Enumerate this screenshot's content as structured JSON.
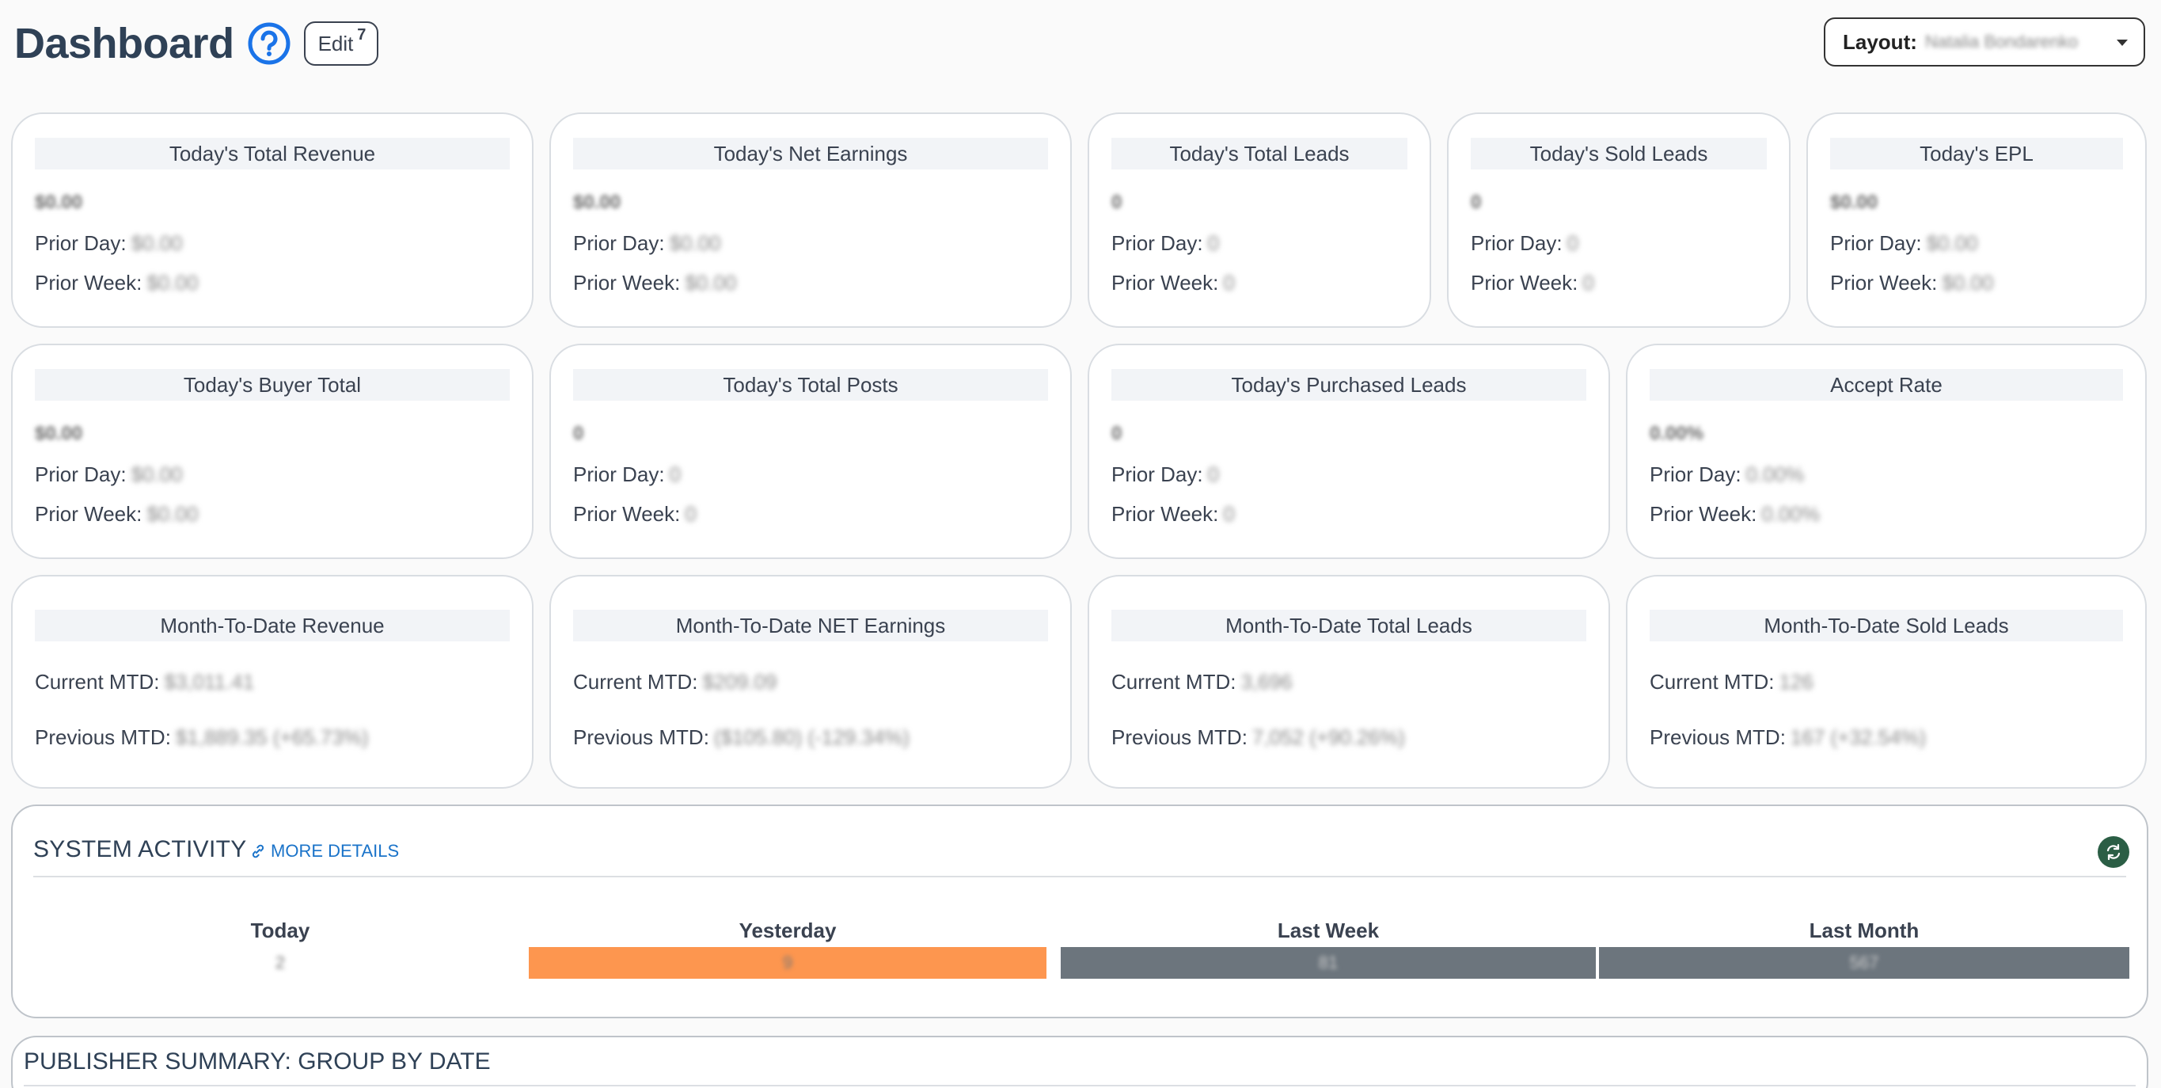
{
  "header": {
    "title": "Dashboard",
    "edit_label": "Edit",
    "edit_badge": "7",
    "layout_label": "Layout:",
    "layout_value": "Natalia Bondarenko"
  },
  "cards_row1": [
    {
      "title": "Today's Total Revenue",
      "value": "$0.00",
      "prior_day_label": "Prior Day:",
      "prior_day": "$0.00",
      "prior_week_label": "Prior Week:",
      "prior_week": "$0.00"
    },
    {
      "title": "Today's Net Earnings",
      "value": "$0.00",
      "prior_day_label": "Prior Day:",
      "prior_day": "$0.00",
      "prior_week_label": "Prior Week:",
      "prior_week": "$0.00"
    },
    {
      "title": "Today's Total Leads",
      "value": "0",
      "prior_day_label": "Prior Day:",
      "prior_day": "0",
      "prior_week_label": "Prior Week:",
      "prior_week": "0"
    },
    {
      "title": "Today's Sold Leads",
      "value": "0",
      "prior_day_label": "Prior Day:",
      "prior_day": "0",
      "prior_week_label": "Prior Week:",
      "prior_week": "0"
    },
    {
      "title": "Today's EPL",
      "value": "$0.00",
      "prior_day_label": "Prior Day:",
      "prior_day": "$0.00",
      "prior_week_label": "Prior Week:",
      "prior_week": "$0.00"
    }
  ],
  "cards_row2": [
    {
      "title": "Today's Buyer Total",
      "value": "$0.00",
      "prior_day_label": "Prior Day:",
      "prior_day": "$0.00",
      "prior_week_label": "Prior Week:",
      "prior_week": "$0.00"
    },
    {
      "title": "Today's Total Posts",
      "value": "0",
      "prior_day_label": "Prior Day:",
      "prior_day": "0",
      "prior_week_label": "Prior Week:",
      "prior_week": "0"
    },
    {
      "title": "Today's Purchased Leads",
      "value": "0",
      "prior_day_label": "Prior Day:",
      "prior_day": "0",
      "prior_week_label": "Prior Week:",
      "prior_week": "0"
    },
    {
      "title": "Accept Rate",
      "value": "0.00%",
      "prior_day_label": "Prior Day:",
      "prior_day": "0.00%",
      "prior_week_label": "Prior Week:",
      "prior_week": "0.00%"
    }
  ],
  "cards_row3": [
    {
      "title": "Month-To-Date Revenue",
      "current_label": "Current MTD:",
      "current": "$3,011.41",
      "previous_label": "Previous MTD:",
      "previous": "$1,889.35 (+65.73%)"
    },
    {
      "title": "Month-To-Date NET Earnings",
      "current_label": "Current MTD:",
      "current": "$209.09",
      "previous_label": "Previous MTD:",
      "previous": "($105.80) (-129.34%)"
    },
    {
      "title": "Month-To-Date Total Leads",
      "current_label": "Current MTD:",
      "current": "3,696",
      "previous_label": "Previous MTD:",
      "previous": "7,052 (+90.26%)"
    },
    {
      "title": "Month-To-Date Sold Leads",
      "current_label": "Current MTD:",
      "current": "126",
      "previous_label": "Previous MTD:",
      "previous": "167 (+32.54%)"
    }
  ],
  "system_activity": {
    "title": "SYSTEM ACTIVITY",
    "more_details": "MORE DETAILS",
    "columns": [
      {
        "label": "Today",
        "value": "2"
      },
      {
        "label": "Yesterday",
        "value": "9"
      },
      {
        "label": "Last Week",
        "value": "81"
      },
      {
        "label": "Last Month",
        "value": "567"
      }
    ],
    "colors": {
      "yesterday": "#fd964f",
      "gray": "#6c757d"
    }
  },
  "publisher_summary": {
    "title": "PUBLISHER SUMMARY: GROUP BY DATE"
  }
}
